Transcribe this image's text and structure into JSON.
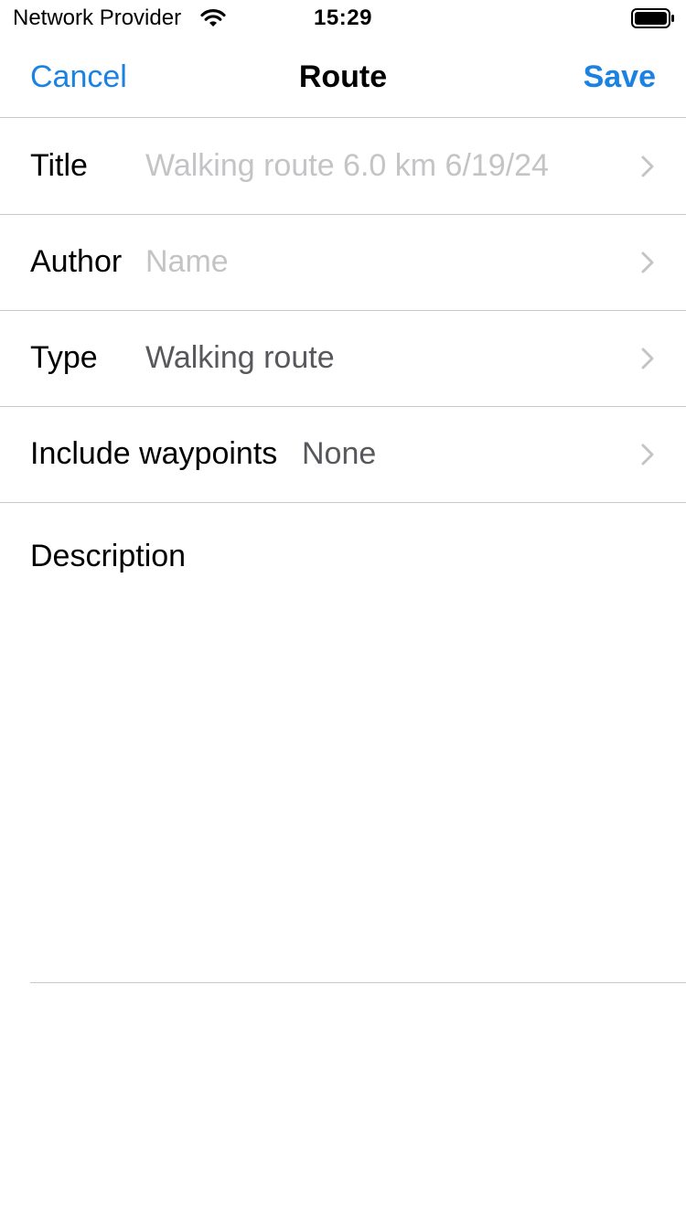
{
  "status_bar": {
    "carrier": "Network Provider",
    "time": "15:29",
    "wifi_icon": "wifi-icon",
    "battery_icon": "battery-icon"
  },
  "nav": {
    "cancel_label": "Cancel",
    "title": "Route",
    "save_label": "Save",
    "accent_color": "#1a82e2"
  },
  "form": {
    "title": {
      "label": "Title",
      "placeholder": "Walking route 6.0 km 6/19/24",
      "value": ""
    },
    "author": {
      "label": "Author",
      "placeholder": "Name",
      "value": ""
    },
    "type": {
      "label": "Type",
      "value": "Walking route"
    },
    "waypoints": {
      "label": "Include waypoints",
      "value": "None"
    },
    "description": {
      "label": "Description",
      "value": ""
    }
  }
}
